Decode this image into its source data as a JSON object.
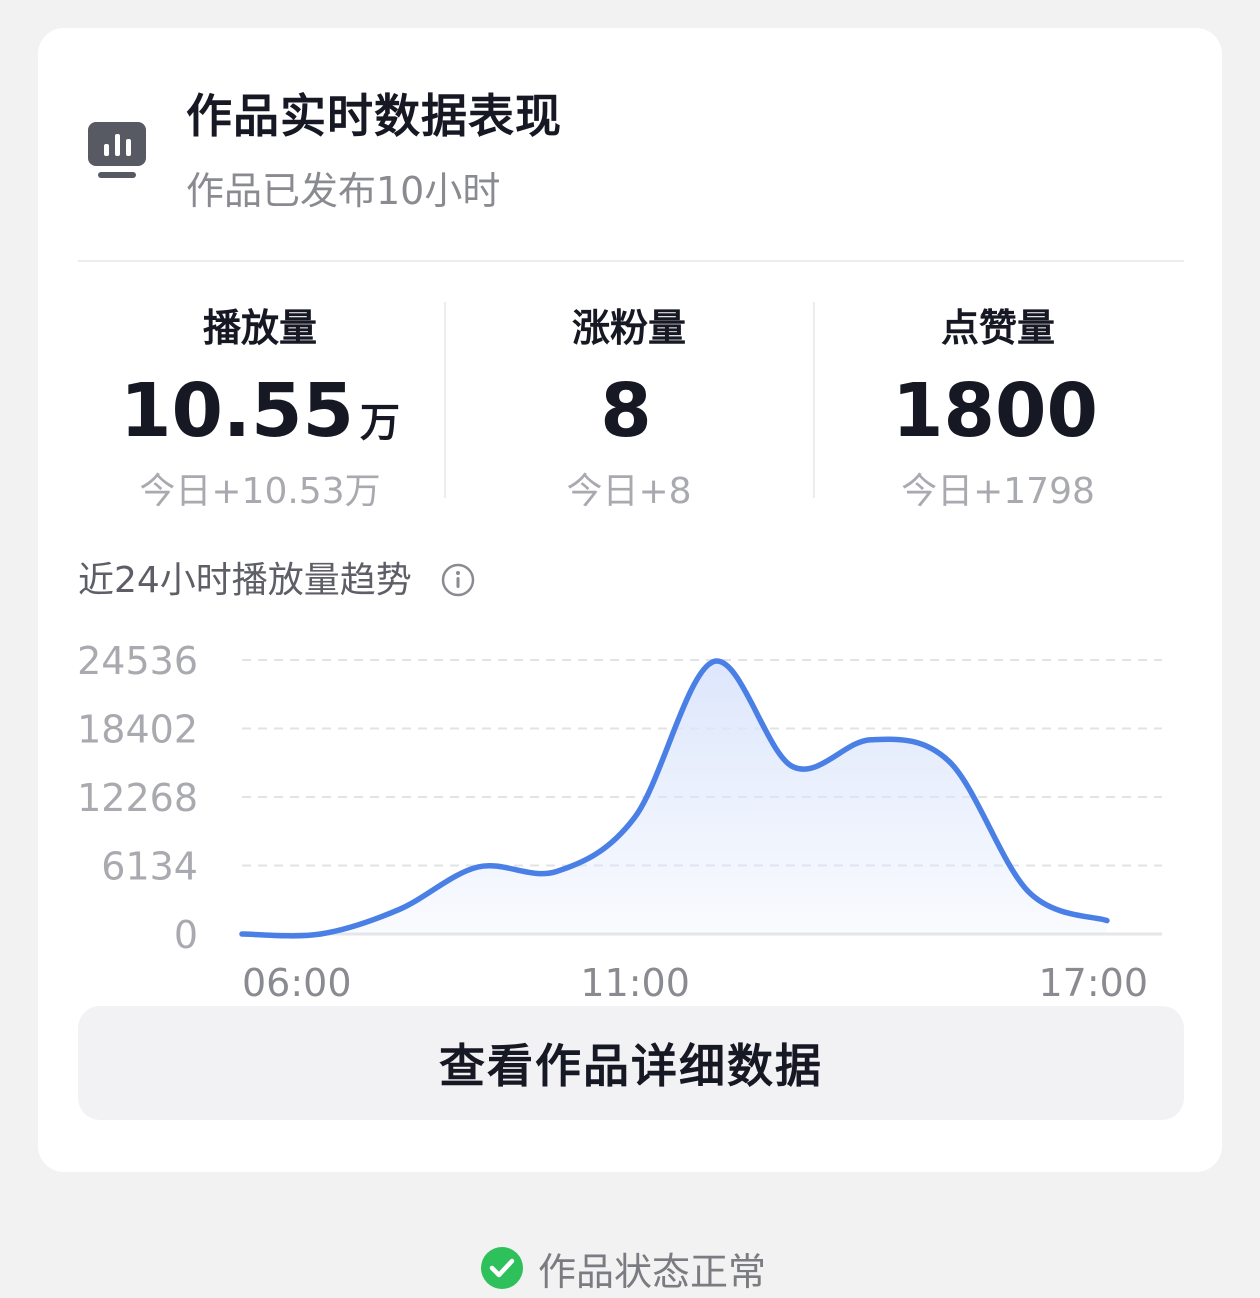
{
  "header": {
    "icon": "bar-chart-icon",
    "title": "作品实时数据表现",
    "subtitle": "作品已发布10小时"
  },
  "stats": [
    {
      "label": "播放量",
      "value": "10.55",
      "unit": "万",
      "today": "今日+10.53万"
    },
    {
      "label": "涨粉量",
      "value": "8",
      "unit": "",
      "today": "今日+8"
    },
    {
      "label": "点赞量",
      "value": "1800",
      "unit": "",
      "today": "今日+1798"
    }
  ],
  "trend": {
    "title": "近24小时播放量趋势",
    "info_icon": "info-icon"
  },
  "chart_data": {
    "type": "area",
    "title": "近24小时播放量趋势",
    "y_ticks": [
      24536,
      18402,
      12268,
      6134,
      0
    ],
    "ylim": [
      0,
      24536
    ],
    "x_tick_labels": [
      {
        "label": "06:00",
        "x": 6
      },
      {
        "label": "11:00",
        "x": 11
      },
      {
        "label": "17:00",
        "x": 17
      }
    ],
    "series": [
      {
        "x": [
          6,
          7,
          8,
          9,
          10,
          11,
          12,
          13,
          14,
          15,
          16,
          17
        ],
        "values": [
          0,
          0,
          2200,
          6000,
          5600,
          10500,
          24400,
          15000,
          17400,
          15400,
          3800,
          1200
        ]
      }
    ],
    "grid": true,
    "colors": {
      "line": "#4a7fe6",
      "fill": "#dbe5fb"
    }
  },
  "cta": {
    "label": "查看作品详细数据"
  },
  "status": {
    "icon": "check-circle-icon",
    "text": "作品状态正常",
    "color": "#2ec15b"
  }
}
